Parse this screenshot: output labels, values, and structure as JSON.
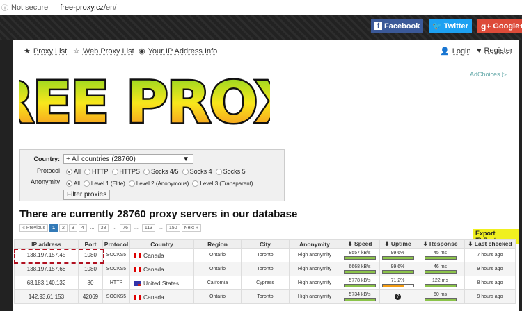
{
  "browser": {
    "security": "Not secure",
    "host": "free-proxy.cz",
    "path": "/en/"
  },
  "social": [
    {
      "label": "Facebook",
      "color": "#3b5998"
    },
    {
      "label": "Twitter",
      "color": "#1da1f2"
    },
    {
      "label": "Google+",
      "color": "#dd4b39"
    }
  ],
  "nav": {
    "proxy_list": "Proxy List",
    "web_proxy_list": "Web Proxy List",
    "ip_info": "Your IP Address Info",
    "login": "Login",
    "register": "Register"
  },
  "logo_text": "FREE PROXY",
  "ad_choices": "AdChoices",
  "filter": {
    "country_label": "Country:",
    "country_value": "+ All countries (28760)",
    "protocol_label": "Protocol",
    "protocols": [
      "All",
      "HTTP",
      "HTTPS",
      "Socks 4/5",
      "Socks 4",
      "Socks 5"
    ],
    "anonymity_label": "Anonymity",
    "anonymity": [
      "All",
      "Level 1 (Elite)",
      "Level 2 (Anonymous)",
      "Level 3 (Transparent)"
    ],
    "button": "Filter proxies"
  },
  "heading": "There are currently 28760 proxy servers in our database",
  "pagination": [
    "« Previous",
    "1",
    "2",
    "3",
    "4",
    "...",
    "38",
    "...",
    "76",
    "...",
    "113",
    "...",
    "150",
    "Next »"
  ],
  "export": "Export IP:Port",
  "table": {
    "headers": [
      "IP address",
      "Port",
      "Protocol",
      "Country",
      "Region",
      "City",
      "Anonymity",
      "Speed",
      "Uptime",
      "Response",
      "Last checked"
    ],
    "rows": [
      {
        "ip": "138.197.157.45",
        "port": "1080",
        "protocol": "SOCKS5",
        "country": "Canada",
        "flag": "ca",
        "region": "Ontario",
        "city": "Toronto",
        "anonymity": "High anonymity",
        "speed": "8557 kB/s",
        "speed_pct": 100,
        "uptime": "99.6%",
        "uptime_pct": 99.6,
        "response": "45 ms",
        "response_pct": 100,
        "checked": "7 hours ago"
      },
      {
        "ip": "138.197.157.68",
        "port": "1080",
        "protocol": "SOCKS5",
        "country": "Canada",
        "flag": "ca",
        "region": "Ontario",
        "city": "Toronto",
        "anonymity": "High anonymity",
        "speed": "6668 kB/s",
        "speed_pct": 100,
        "uptime": "99.6%",
        "uptime_pct": 99.6,
        "response": "46 ms",
        "response_pct": 100,
        "checked": "9 hours ago"
      },
      {
        "ip": "68.183.140.132",
        "port": "80",
        "protocol": "HTTP",
        "country": "United States",
        "flag": "us",
        "region": "California",
        "city": "Cypress",
        "anonymity": "High anonymity",
        "speed": "5778 kB/s",
        "speed_pct": 100,
        "uptime": "71.2%",
        "uptime_pct": 71.2,
        "response": "122 ms",
        "response_pct": 100,
        "checked": "8 hours ago"
      },
      {
        "ip": "142.93.61.153",
        "port": "42069",
        "protocol": "SOCKS5",
        "country": "Canada",
        "flag": "ca",
        "region": "Ontario",
        "city": "Toronto",
        "anonymity": "High anonymity",
        "speed": "5734 kB/s",
        "speed_pct": 100,
        "uptime": "?",
        "uptime_pct": null,
        "response": "60 ms",
        "response_pct": 100,
        "checked": "9 hours ago"
      }
    ]
  }
}
